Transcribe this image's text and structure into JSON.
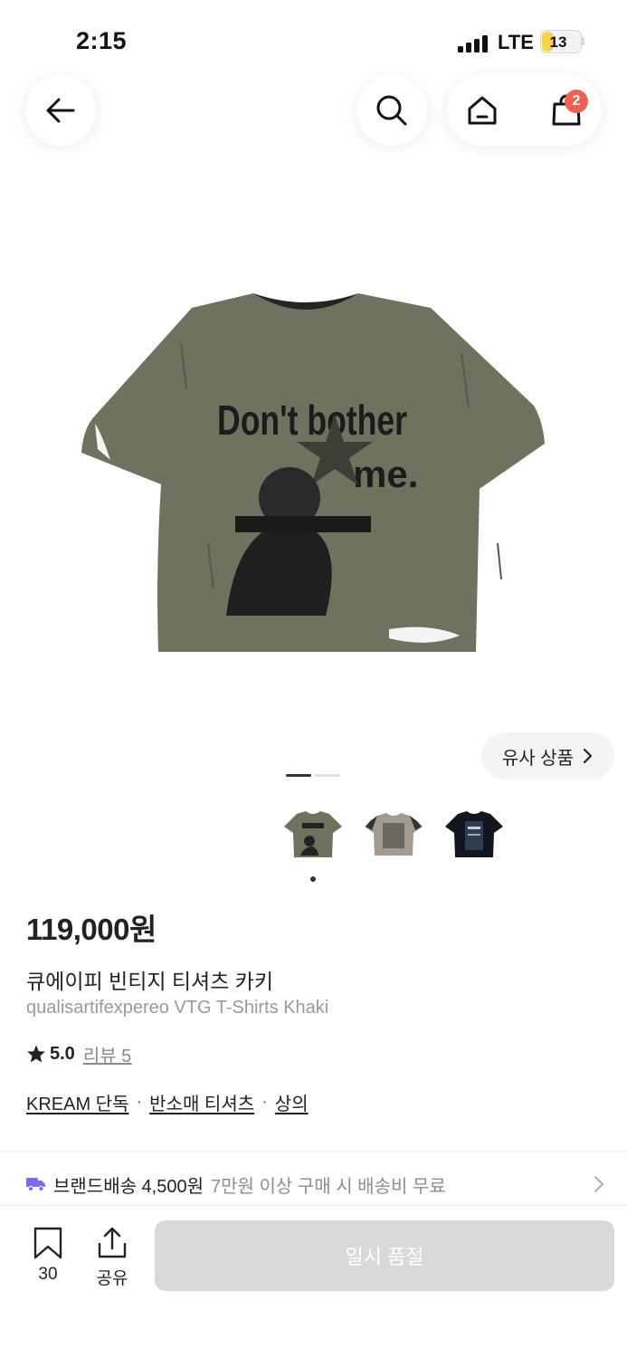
{
  "status_bar": {
    "time": "2:15",
    "network": "LTE",
    "battery_level": "13",
    "battery_fraction": 0.13,
    "battery_color": "#f6d645"
  },
  "nav": {
    "back_icon": "arrow-left-icon",
    "search_icon": "search-icon",
    "home_icon": "home-icon",
    "cart_icon": "shopping-bag-icon",
    "cart_badge": "2",
    "badge_color": "#ef6253"
  },
  "gallery": {
    "similar_products_label": "유사 상품",
    "page_count": 2,
    "active_page": 1,
    "shirt_print": {
      "line1": "Don't bother",
      "line2": "me."
    },
    "thumbnail_count": 3,
    "thumbnail_active": 1
  },
  "product": {
    "price": "119,000원",
    "name_ko": "큐에이피 빈티지 티셔츠 카키",
    "name_en": "qualisartifexpereo VTG T-Shirts Khaki",
    "rating": "5.0",
    "review_label": "리뷰 5",
    "tags": [
      "KREAM 단독",
      "반소매 티셔츠",
      "상의"
    ]
  },
  "delivery": {
    "icon": "truck-icon",
    "icon_color": "#7b6cf6",
    "label": "브랜드배송 4,500원",
    "note": "7만원 이상 구매 시 배송비 무료"
  },
  "bottom_bar": {
    "save_icon": "bookmark-icon",
    "save_count": "30",
    "share_icon": "share-icon",
    "share_label": "공유",
    "soldout_label": "일시 품절"
  }
}
